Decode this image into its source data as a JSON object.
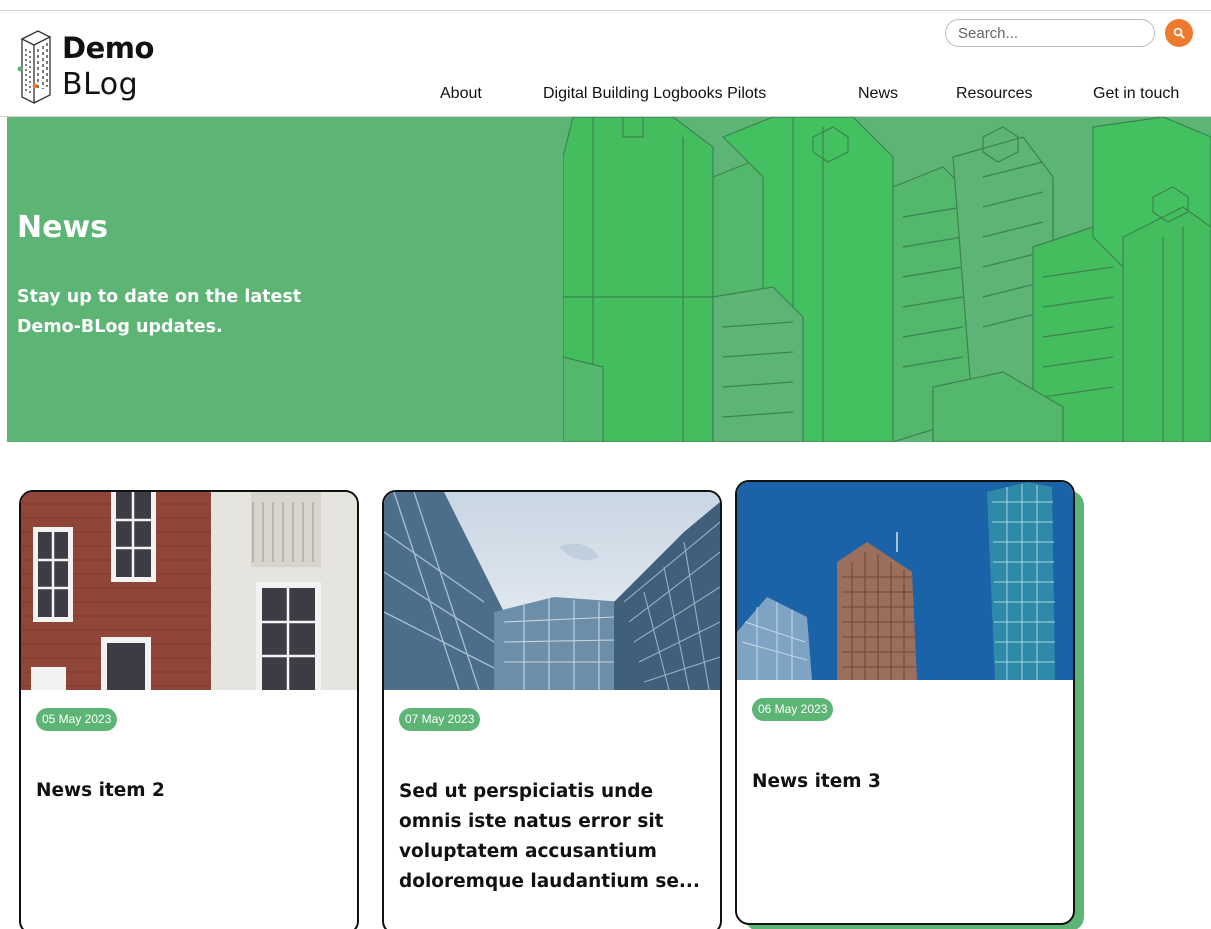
{
  "brand": {
    "line1": "Demo",
    "line2": "BLog"
  },
  "search": {
    "placeholder": "Search..."
  },
  "nav": {
    "items": [
      {
        "label": "About"
      },
      {
        "label": "Digital Building Logbooks Pilots"
      },
      {
        "label": "News"
      },
      {
        "label": "Resources"
      },
      {
        "label": "Get in touch"
      }
    ]
  },
  "hero": {
    "title": "News",
    "subtitle": "Stay up to date on the latest Demo-BLog updates."
  },
  "cards": [
    {
      "date": "05 May 2023",
      "title": "News item 2"
    },
    {
      "date": "07 May 2023",
      "title": "Sed ut perspiciatis unde omnis iste natus error sit voluptatem accusantium doloremque laudantium se..."
    },
    {
      "date": "06 May 2023",
      "title": "News item 3"
    }
  ],
  "colors": {
    "brand_green": "#5cb574",
    "search_orange": "#ee7a2e",
    "text": "#111111"
  }
}
